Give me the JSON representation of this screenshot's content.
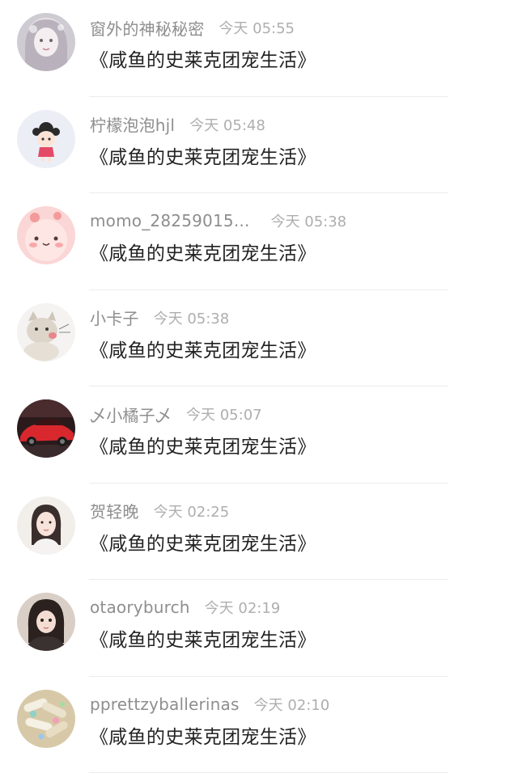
{
  "comments": [
    {
      "username": "窗外的神秘秘密",
      "time": "今天 05:55",
      "message": "《咸鱼的史莱克团宠生活》",
      "avatar": "girl-illustration-avatar"
    },
    {
      "username": "柠檬泡泡hjl",
      "time": "今天 05:48",
      "message": "《咸鱼的史莱克团宠生活》",
      "avatar": "cartoon-girl-avatar"
    },
    {
      "username": "momo_28259015...",
      "time": "今天 05:38",
      "message": "《咸鱼的史莱克团宠生活》",
      "avatar": "pink-cartoon-avatar"
    },
    {
      "username": "小卡子",
      "time": "今天 05:38",
      "message": "《咸鱼的史莱克团宠生活》",
      "avatar": "cat-drawing-avatar"
    },
    {
      "username": "乄小橘子乄",
      "time": "今天 05:07",
      "message": "《咸鱼的史莱克团宠生活》",
      "avatar": "red-car-avatar"
    },
    {
      "username": "贺轻晚",
      "time": "今天 02:25",
      "message": "《咸鱼的史莱克团宠生活》",
      "avatar": "girl-photo-avatar"
    },
    {
      "username": "otaoryburch",
      "time": "今天 02:19",
      "message": "《咸鱼的史莱克团宠生活》",
      "avatar": "girl-photo-avatar"
    },
    {
      "username": "pprettzyballerinas",
      "time": "今天 02:10",
      "message": "《咸鱼的史莱克团宠生活》",
      "avatar": "food-photo-avatar"
    }
  ]
}
